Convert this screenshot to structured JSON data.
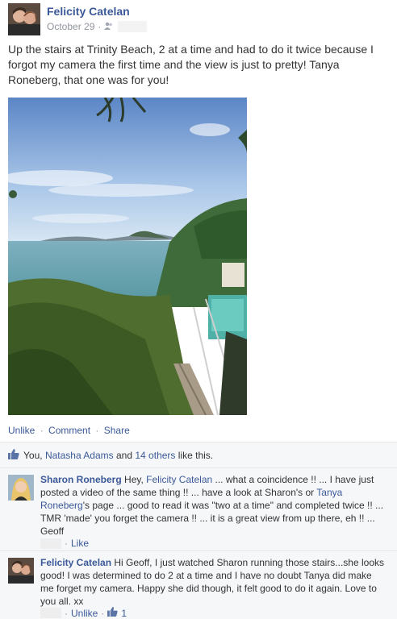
{
  "post": {
    "author": "Felicity Catelan",
    "date": "October 29",
    "audience_icon": "friends-icon",
    "text": "Up the stairs at Trinity Beach, 2 at a time and had to do it twice because I forgot my camera the first time and the view is just to pretty! Tanya Roneberg, that one was for you!"
  },
  "actions": {
    "unlike": "Unlike",
    "comment": "Comment",
    "share": "Share",
    "separator": "·"
  },
  "likes": {
    "you": "You,",
    "person": "Natasha Adams",
    "and": "and",
    "others": "14 others",
    "suffix": "like this."
  },
  "comments": [
    {
      "author": "Sharon Roneberg",
      "text_1": " Hey, ",
      "mention_1": "Felicity Catelan",
      "text_2": " ... what a coincidence !! ... I have just posted a video of the same thing !! ... have a look at Sharon's or ",
      "mention_2": "Tanya Roneberg",
      "text_3": "'s page ... good to read it was \"two at a time\" and completed twice !! ... TMR 'made' you forget the camera !! ... it is a great view from up there, eh !! ... Geoff",
      "like_label": "Like",
      "dot": "·"
    },
    {
      "author": "Felicity Catelan",
      "text": " Hi Geoff, I just watched Sharon running those stairs...she looks good! I was determined to do 2 at a time and I have no doubt Tanya did make me forget my camera. Happy she did though, it felt good to do it again. Love to you all. xx",
      "unlike_label": "Unlike",
      "like_count": "1",
      "dot": "·"
    }
  ],
  "colors": {
    "link": "#3b5998",
    "meta": "#90949c",
    "comment_bg": "#f6f7f9"
  }
}
